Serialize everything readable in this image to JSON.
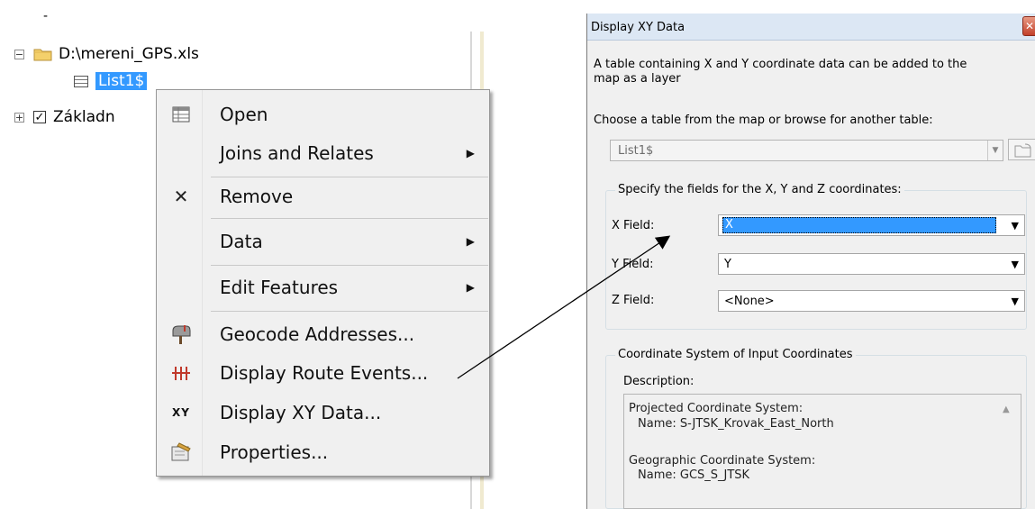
{
  "toc": {
    "top_marker": "-",
    "items": [
      {
        "label": "D:\\mereni_GPS.xls",
        "expander": "−",
        "type": "folder"
      },
      {
        "label": "List1$",
        "type": "table",
        "selected": true
      },
      {
        "label": "Základn",
        "expander": "+",
        "type": "layer",
        "checked": true
      }
    ]
  },
  "context_menu": {
    "items": [
      {
        "label": "Open",
        "icon": "table-icon"
      },
      {
        "label": "Joins and Relates",
        "submenu_arrow": "▶"
      },
      {
        "label": "Remove",
        "icon": "remove-x-icon",
        "icon_glyph": "✕"
      },
      {
        "label": "Data",
        "submenu_arrow": "▶"
      },
      {
        "label": "Edit Features",
        "submenu_arrow": "▶"
      },
      {
        "label": "Geocode Addresses...",
        "icon": "geocode-mailbox-icon"
      },
      {
        "label": "Display Route Events...",
        "icon": "route-events-icon"
      },
      {
        "label": "Display XY Data...",
        "icon": "xy-data-icon",
        "icon_glyph": "XY"
      },
      {
        "label": "Properties...",
        "icon": "properties-icon"
      }
    ]
  },
  "dialog": {
    "title": "Display XY Data",
    "close_glyph": "✕",
    "intro_line1": "A table containing X and Y coordinate data can be added to the",
    "intro_line2": "map as a layer",
    "choose_label": "Choose a table from the map or browse for another table:",
    "table_value": "List1$",
    "fields_group": "Specify the fields for the X, Y and Z coordinates:",
    "x_label": "X Field:",
    "x_value": "X",
    "y_label": "Y Field:",
    "y_value": "Y",
    "z_label": "Z Field:",
    "z_value": "<None>",
    "coord_group": "Coordinate System of Input Coordinates",
    "description_label": "Description:",
    "description": {
      "projected_heading": "Projected Coordinate System:",
      "projected_name": "Name: S-JTSK_Krovak_East_North",
      "geographic_heading": "Geographic Coordinate System:",
      "geographic_name": "Name: GCS_S_JTSK"
    },
    "dropdown_glyph": "▼"
  },
  "colors": {
    "selection_blue": "#3399ff",
    "menu_bg": "#f0f0f0",
    "folder_yellow": "#f4d06b",
    "close_red": "#c2412b"
  }
}
